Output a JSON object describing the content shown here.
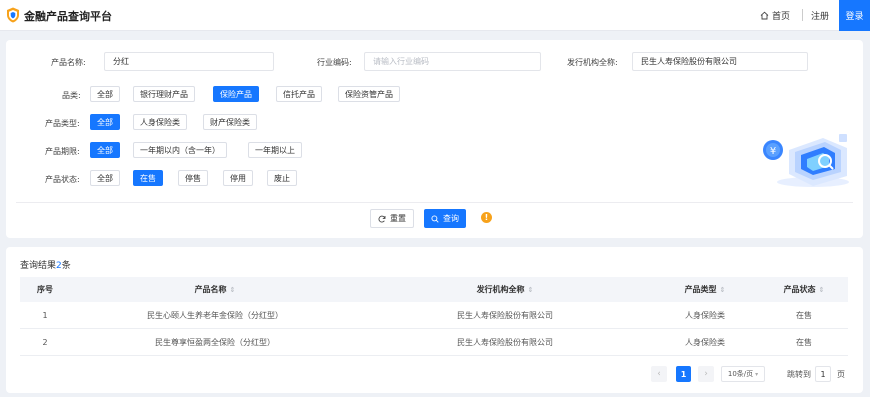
{
  "header": {
    "app_title": "金融产品查询平台",
    "nav_home": "首页",
    "nav_register": "注册",
    "nav_login": "登录",
    "brand_color": "#1677ff"
  },
  "filters": {
    "product_name_label": "产品名称:",
    "product_name_value": "分红",
    "industry_code_label": "行业编码:",
    "industry_code_placeholder": "请输入行业编码",
    "issuer_label": "发行机构全称:",
    "issuer_value": "民生人寿保险股份有限公司",
    "category_label": "品类:",
    "category_options": [
      "全部",
      "银行理财产品",
      "保险产品",
      "信托产品",
      "保险资管产品"
    ],
    "category_selected": "保险产品",
    "type_label": "产品类型:",
    "type_options": [
      "全部",
      "人身保险类",
      "财产保险类"
    ],
    "type_selected": "全部",
    "term_label": "产品期限:",
    "term_options": [
      "全部",
      "一年期以内（含一年）",
      "一年期以上"
    ],
    "term_selected": "全部",
    "status_label": "产品状态:",
    "status_options": [
      "全部",
      "在售",
      "停售",
      "停用",
      "废止"
    ],
    "status_selected": "在售",
    "reset_label": "重置",
    "search_label": "查询",
    "warn_symbol": "!"
  },
  "results": {
    "count_prefix": "查询结果",
    "count": "2",
    "count_suffix": "条",
    "columns": [
      "序号",
      "产品名称",
      "发行机构全称",
      "产品类型",
      "产品状态"
    ],
    "rows": [
      [
        "1",
        "民生心颐人生养老年金保险（分红型）",
        "民生人寿保险股份有限公司",
        "人身保险类",
        "在售"
      ],
      [
        "2",
        "民生尊享恒盈两全保险（分红型）",
        "民生人寿保险股份有限公司",
        "人身保险类",
        "在售"
      ]
    ]
  },
  "pagination": {
    "current_page": "1",
    "page_size": "10条/页",
    "jump_label": "跳转到",
    "jump_value": "1",
    "jump_unit": "页",
    "prev_symbol": "‹",
    "next_symbol": "›"
  }
}
